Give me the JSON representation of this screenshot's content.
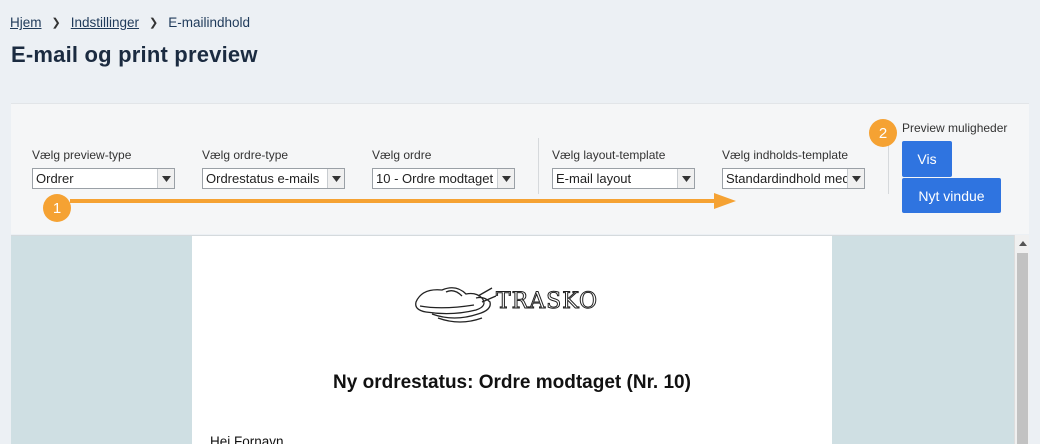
{
  "breadcrumb": {
    "home": "Hjem",
    "settings": "Indstillinger",
    "current": "E-mailindhold"
  },
  "page_title": "E-mail og print preview",
  "filters": {
    "preview_type": {
      "label": "Vælg preview-type",
      "value": "Ordrer"
    },
    "order_type": {
      "label": "Vælg ordre-type",
      "value": "Ordrestatus e-mails"
    },
    "order": {
      "label": "Vælg ordre",
      "value": "10 - Ordre modtaget"
    },
    "layout_template": {
      "label": "Vælg layout-template",
      "value": "E-mail layout"
    },
    "content_template": {
      "label": "Vælg indholds-template",
      "value": "Standardindhold med"
    }
  },
  "preview_options": {
    "label": "Preview muligheder",
    "show_button": "Vis",
    "new_window_button": "Nyt vindue"
  },
  "markers": {
    "one": "1",
    "two": "2"
  },
  "accent_color": "#2f74e0",
  "marker_color": "#f5a233",
  "email": {
    "logo_text": "TRASKO",
    "heading": "Ny ordrestatus: Ordre modtaget (Nr. 10)",
    "greeting": "Hej Fornavn"
  }
}
